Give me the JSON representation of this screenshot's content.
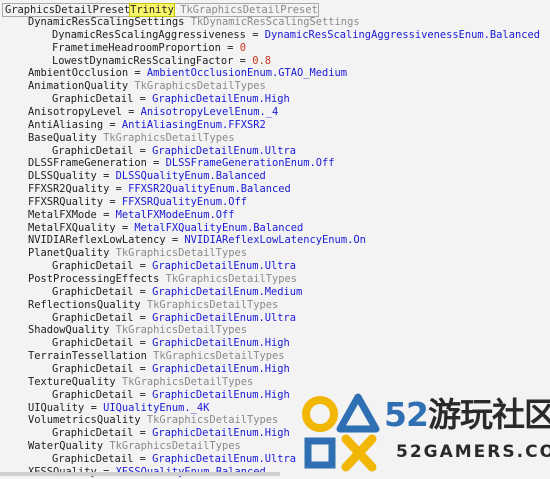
{
  "root": {
    "name": "GraphicsDetailPreset",
    "value": "Trinity",
    "type": "TkGraphicsDetailPreset"
  },
  "rows": [
    {
      "indent": 1,
      "name": "DynamicResScalingSettings",
      "type": "TkDynamicResScalingSettings"
    },
    {
      "indent": 2,
      "name": "DynamicResScalingAggressiveness",
      "value": "DynamicResScalingAggressivenessEnum.Balanced",
      "value_kind": "enum"
    },
    {
      "indent": 2,
      "name": "FrametimeHeadroomProportion",
      "value": "0",
      "value_kind": "number"
    },
    {
      "indent": 2,
      "name": "LowestDynamicResScalingFactor",
      "value": "0.8",
      "value_kind": "number"
    },
    {
      "indent": 1,
      "name": "AmbientOcclusion",
      "value": "AmbientOcclusionEnum.GTAO_Medium",
      "value_kind": "enum"
    },
    {
      "indent": 1,
      "name": "AnimationQuality",
      "type": "TkGraphicsDetailTypes"
    },
    {
      "indent": 2,
      "name": "GraphicDetail",
      "value": "GraphicDetailEnum.High",
      "value_kind": "enum"
    },
    {
      "indent": 1,
      "name": "AnisotropyLevel",
      "value": "AnisotropyLevelEnum._4",
      "value_kind": "enum"
    },
    {
      "indent": 1,
      "name": "AntiAliasing",
      "value": "AntiAliasingEnum.FFXSR2",
      "value_kind": "enum"
    },
    {
      "indent": 1,
      "name": "BaseQuality",
      "type": "TkGraphicsDetailTypes"
    },
    {
      "indent": 2,
      "name": "GraphicDetail",
      "value": "GraphicDetailEnum.Ultra",
      "value_kind": "enum"
    },
    {
      "indent": 1,
      "name": "DLSSFrameGeneration",
      "value": "DLSSFrameGenerationEnum.Off",
      "value_kind": "enum"
    },
    {
      "indent": 1,
      "name": "DLSSQuality",
      "value": "DLSSQualityEnum.Balanced",
      "value_kind": "enum"
    },
    {
      "indent": 1,
      "name": "FFXSR2Quality",
      "value": "FFXSR2QualityEnum.Balanced",
      "value_kind": "enum"
    },
    {
      "indent": 1,
      "name": "FFXSRQuality",
      "value": "FFXSRQualityEnum.Off",
      "value_kind": "enum"
    },
    {
      "indent": 1,
      "name": "MetalFXMode",
      "value": "MetalFXModeEnum.Off",
      "value_kind": "enum"
    },
    {
      "indent": 1,
      "name": "MetalFXQuality",
      "value": "MetalFXQualityEnum.Balanced",
      "value_kind": "enum"
    },
    {
      "indent": 1,
      "name": "NVIDIAReflexLowLatency",
      "value": "NVIDIAReflexLowLatencyEnum.On",
      "value_kind": "enum"
    },
    {
      "indent": 1,
      "name": "PlanetQuality",
      "type": "TkGraphicsDetailTypes"
    },
    {
      "indent": 2,
      "name": "GraphicDetail",
      "value": "GraphicDetailEnum.Ultra",
      "value_kind": "enum"
    },
    {
      "indent": 1,
      "name": "PostProcessingEffects",
      "type": "TkGraphicsDetailTypes"
    },
    {
      "indent": 2,
      "name": "GraphicDetail",
      "value": "GraphicDetailEnum.Medium",
      "value_kind": "enum"
    },
    {
      "indent": 1,
      "name": "ReflectionsQuality",
      "type": "TkGraphicsDetailTypes"
    },
    {
      "indent": 2,
      "name": "GraphicDetail",
      "value": "GraphicDetailEnum.Ultra",
      "value_kind": "enum"
    },
    {
      "indent": 1,
      "name": "ShadowQuality",
      "type": "TkGraphicsDetailTypes"
    },
    {
      "indent": 2,
      "name": "GraphicDetail",
      "value": "GraphicDetailEnum.High",
      "value_kind": "enum"
    },
    {
      "indent": 1,
      "name": "TerrainTessellation",
      "type": "TkGraphicsDetailTypes"
    },
    {
      "indent": 2,
      "name": "GraphicDetail",
      "value": "GraphicDetailEnum.High",
      "value_kind": "enum"
    },
    {
      "indent": 1,
      "name": "TextureQuality",
      "type": "TkGraphicsDetailTypes"
    },
    {
      "indent": 2,
      "name": "GraphicDetail",
      "value": "GraphicDetailEnum.High",
      "value_kind": "enum"
    },
    {
      "indent": 1,
      "name": "UIQuality",
      "value": "UIQualityEnum._4K",
      "value_kind": "enum"
    },
    {
      "indent": 1,
      "name": "VolumetricsQuality",
      "type": "TkGraphicsDetailTypes"
    },
    {
      "indent": 2,
      "name": "GraphicDetail",
      "value": "GraphicDetailEnum.High",
      "value_kind": "enum"
    },
    {
      "indent": 1,
      "name": "WaterQuality",
      "type": "TkGraphicsDetailTypes"
    },
    {
      "indent": 2,
      "name": "GraphicDetail",
      "value": "GraphicDetailEnum.Ultra",
      "value_kind": "enum"
    },
    {
      "indent": 1,
      "name": "XESSQuality",
      "value": "XESSQualityEnum.Balanced",
      "value_kind": "enum"
    }
  ],
  "watermark": {
    "title_digits": "52",
    "title_text": "游玩社区",
    "url": "52GAMERS.COM"
  },
  "colors": {
    "name": "#1e1e1e",
    "type": "#8a8a8a",
    "enum_value": "#1a1ad6",
    "number_value": "#c7361c",
    "highlight": "#f7f56a",
    "watermark_blue": "#2f6fb3",
    "watermark_yellow": "#f2b705"
  }
}
